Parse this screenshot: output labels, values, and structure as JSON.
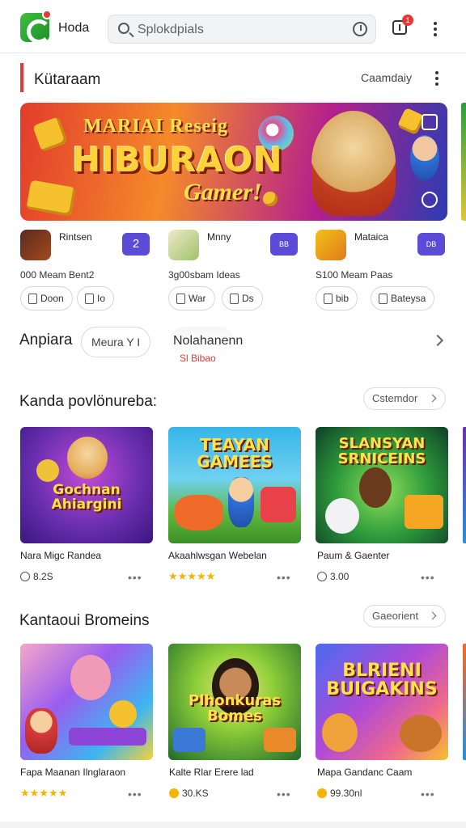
{
  "header": {
    "app_name": "Hoda",
    "search_placeholder": "Splokdpials",
    "notification_count": "1"
  },
  "section": {
    "title": "Kütaraam",
    "link": "Caamdaiy"
  },
  "hero": {
    "subtitle": "MARIAI Reseig",
    "title": "HIBURAON",
    "tagline": "Gamer!"
  },
  "apps": [
    {
      "name": "Rintsen",
      "badge": "2",
      "meta": "000 Meam Bent2",
      "buttons": [
        "Doon",
        "Io"
      ],
      "icon_color": "#5a2a1e"
    },
    {
      "name": "Mnny",
      "badge": "BB",
      "meta": "3g00sbam Ideas",
      "buttons": [
        "War",
        "Ds"
      ],
      "icon_color": "#e9e3c2"
    },
    {
      "name": "Mataica",
      "badge": "DB",
      "meta": "S100 Meam Paas",
      "buttons": [
        "bib",
        "Bateysa"
      ],
      "icon_color": "#f2c21b"
    }
  ],
  "tabs": {
    "title": "Anpiara",
    "chip1": "Meura Y I",
    "chip2": "Nolahanenn",
    "chip2_sub": "Sl Bibao"
  },
  "grid1": {
    "title": "Kanda povlönureba:",
    "see_all": "Cstemdor",
    "games": [
      {
        "art_title": "Gochnan Ahiargini",
        "name": "Nara Migc Randea",
        "rating": "8.2S",
        "rating_type": "time"
      },
      {
        "art_title": "TEAYAN GAMEES",
        "name": "Akaahlwsgan Webelan",
        "rating": "★★★★★",
        "rating_type": "stars"
      },
      {
        "art_title": "SLANSYAN SRNICEINS",
        "name": "Paum & Gaenter",
        "rating": "3.00",
        "rating_type": "time"
      }
    ]
  },
  "grid2": {
    "title": "Kantaoui Bromeins",
    "see_all": "Gaeorient",
    "games": [
      {
        "art_title": "",
        "name": "Fapa Maanan Ilnglaraon",
        "rating": "★★★★★",
        "rating_type": "stars"
      },
      {
        "art_title": "Plhonkuras Bomes",
        "name": "Kalte Rlar Erere lad",
        "rating": "30.KS",
        "rating_type": "coin"
      },
      {
        "art_title": "BLRIENI BUIGAKINS",
        "name": "Mapa Gandanc Caam",
        "rating": "99.30nl",
        "rating_type": "coin"
      }
    ]
  },
  "colors": {
    "accent_red": "#e53935",
    "badge_purple": "#5b4bd6",
    "star_gold": "#f5b400"
  }
}
